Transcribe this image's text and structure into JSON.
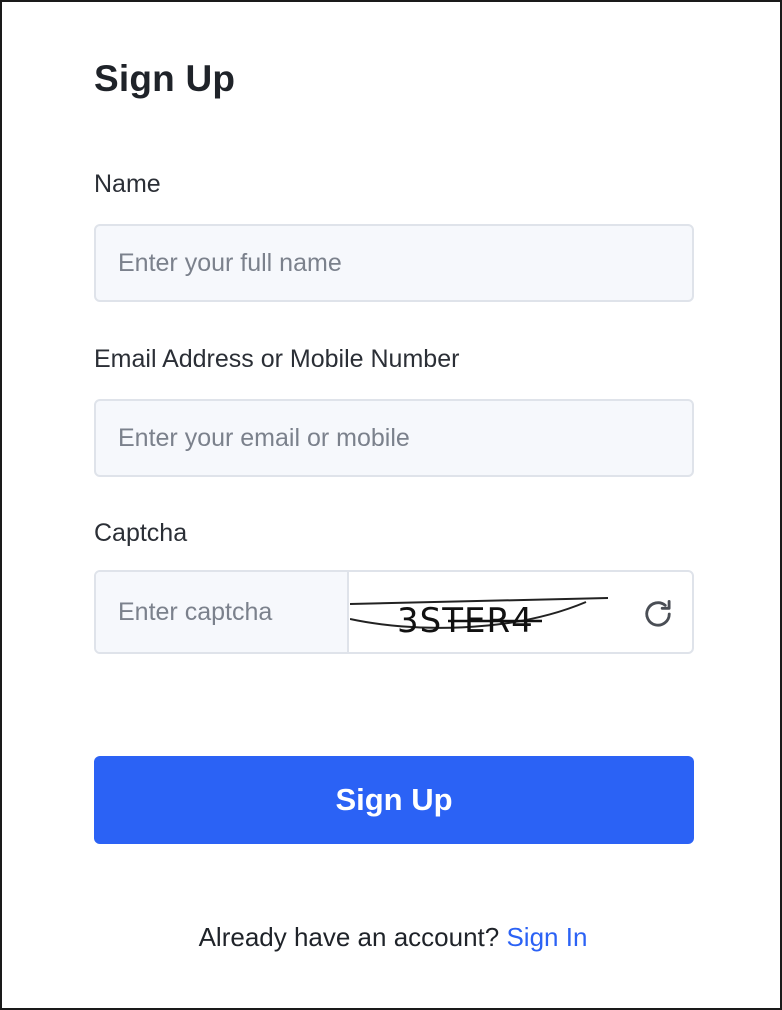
{
  "form": {
    "title": "Sign Up",
    "name_label": "Name",
    "name_placeholder": "Enter your full name",
    "contact_label": "Email Address or Mobile Number",
    "contact_placeholder": "Enter your email or mobile",
    "captcha_label": "Captcha",
    "captcha_placeholder": "Enter captcha",
    "captcha_text": "3STER4",
    "refresh_icon": "refresh-icon",
    "submit_label": "Sign Up"
  },
  "footer": {
    "prompt": "Already have an account?",
    "link_label": "Sign In"
  },
  "colors": {
    "accent": "#2b62f5",
    "input_bg": "#f6f8fc",
    "input_border": "#dfe3ea"
  }
}
